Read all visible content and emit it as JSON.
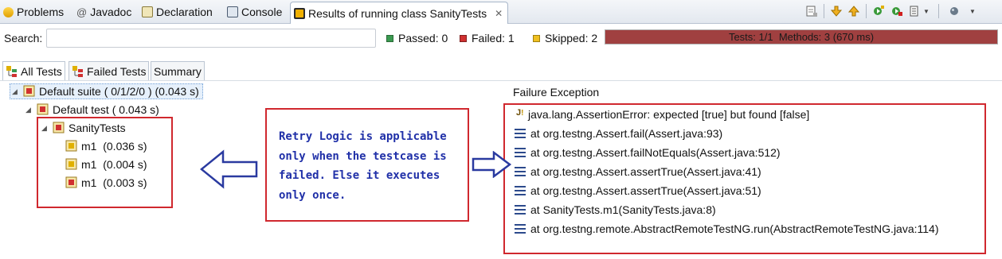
{
  "tabs": [
    {
      "label": "Problems",
      "icon": "problems-icon"
    },
    {
      "label": "Javadoc",
      "icon": "javadoc-icon"
    },
    {
      "label": "Declaration",
      "icon": "declaration-icon"
    },
    {
      "label": "Console",
      "icon": "console-icon"
    },
    {
      "label": "Results of running class SanityTests",
      "icon": "testng-icon",
      "active": true
    }
  ],
  "toolbar_icons": [
    "scroll-lock-icon",
    "next-failure-icon",
    "previous-failure-icon",
    "rerun-icon",
    "rerun-failed-icon",
    "layout-menu-icon",
    "run-history-icon",
    "view-menu-icon"
  ],
  "search": {
    "label": "Search:",
    "value": ""
  },
  "stats": {
    "passed": "Passed: 0",
    "failed": "Failed: 1",
    "skipped": "Skipped: 2"
  },
  "progress": {
    "text": "Tests: 1/1  Methods: 3 (670 ms)",
    "fraction": 1.0,
    "color": "#a04040"
  },
  "subtabs": [
    "All Tests",
    "Failed Tests",
    "Summary"
  ],
  "tree": {
    "suite": "Default suite ( 0/1/2/0 ) (0.043 s)",
    "test": "Default test ( 0.043 s)",
    "class": "SanityTests",
    "methods": [
      {
        "label": "m1  (0.036 s)",
        "status": "skipped"
      },
      {
        "label": "m1  (0.004 s)",
        "status": "skipped"
      },
      {
        "label": "m1  (0.003 s)",
        "status": "failed"
      }
    ]
  },
  "callout": {
    "text": "Retry Logic is applicable\nonly when the testcase is\nfailed. Else it executes\nonly once."
  },
  "failure": {
    "title": "Failure Exception",
    "exception": "java.lang.AssertionError: expected [true] but found [false]",
    "trace": [
      "at org.testng.Assert.fail(Assert.java:93)",
      "at org.testng.Assert.failNotEquals(Assert.java:512)",
      "at org.testng.Assert.assertTrue(Assert.java:41)",
      "at org.testng.Assert.assertTrue(Assert.java:51)",
      "at SanityTests.m1(SanityTests.java:8)",
      "at org.testng.remote.AbstractRemoteTestNG.run(AbstractRemoteTestNG.java:114)"
    ]
  },
  "colors": {
    "annotation_red": "#d0282e",
    "annotation_blue": "#2030a8",
    "progress_red": "#a04040"
  }
}
